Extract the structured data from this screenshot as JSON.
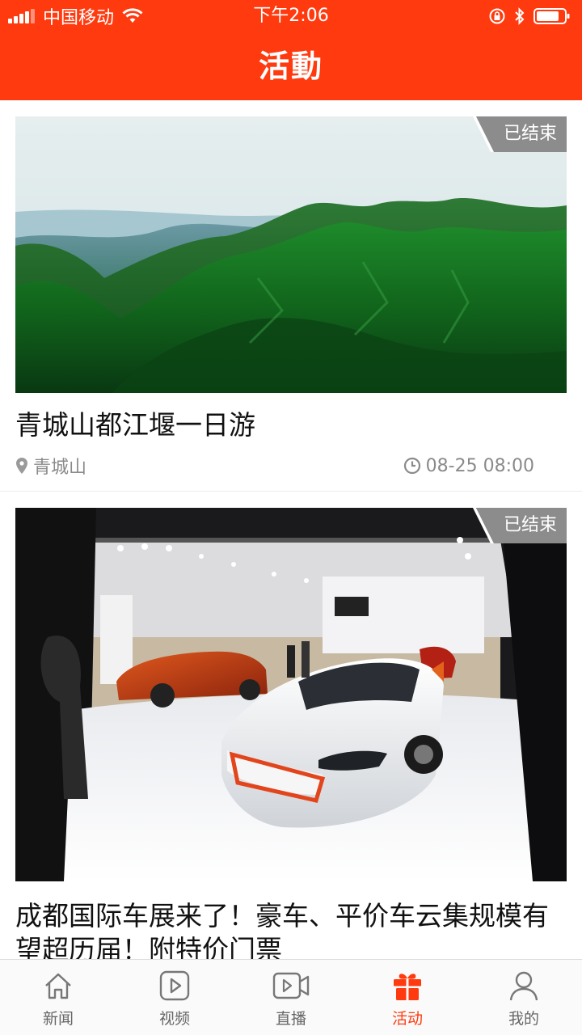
{
  "status_bar": {
    "carrier": "中国移动",
    "time": "下午2:06"
  },
  "header": {
    "title": "活動"
  },
  "cards": [
    {
      "badge": "已结束",
      "title": "青城山都江堰一日游",
      "location": "青城山",
      "datetime": "08-25 08:00"
    },
    {
      "badge": "已结束",
      "title": "成都国际车展来了！豪车、平价车云集规模有望超历届！附特价门票"
    }
  ],
  "tabbar": {
    "items": [
      {
        "label": "新闻",
        "icon": "home-icon"
      },
      {
        "label": "视频",
        "icon": "play-icon"
      },
      {
        "label": "直播",
        "icon": "live-camera-icon"
      },
      {
        "label": "活动",
        "icon": "gift-icon"
      },
      {
        "label": "我的",
        "icon": "user-icon"
      }
    ],
    "active_index": 3
  },
  "colors": {
    "accent": "#ff3a0f",
    "badge": "#8c8c8c"
  }
}
